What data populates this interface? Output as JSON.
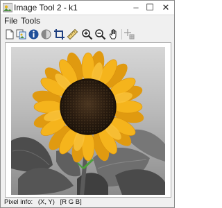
{
  "window": {
    "title": "Image Tool 2 - k1"
  },
  "menu": {
    "file": "File",
    "tools": "Tools"
  },
  "toolbar": {
    "icons": [
      "new-figure-icon",
      "copy-icon",
      "info-icon",
      "contrast-icon",
      "crop-icon",
      "distance-icon",
      "zoom-in-icon",
      "zoom-out-icon",
      "pan-icon",
      "pixel-region-icon"
    ]
  },
  "status": {
    "label": "Pixel info:",
    "coords": "(X, Y)",
    "value": "[R G B]"
  },
  "colors": {
    "petal": "#f2ad18",
    "center": "#2a1c10",
    "background_gray": "#9a9a9a"
  }
}
